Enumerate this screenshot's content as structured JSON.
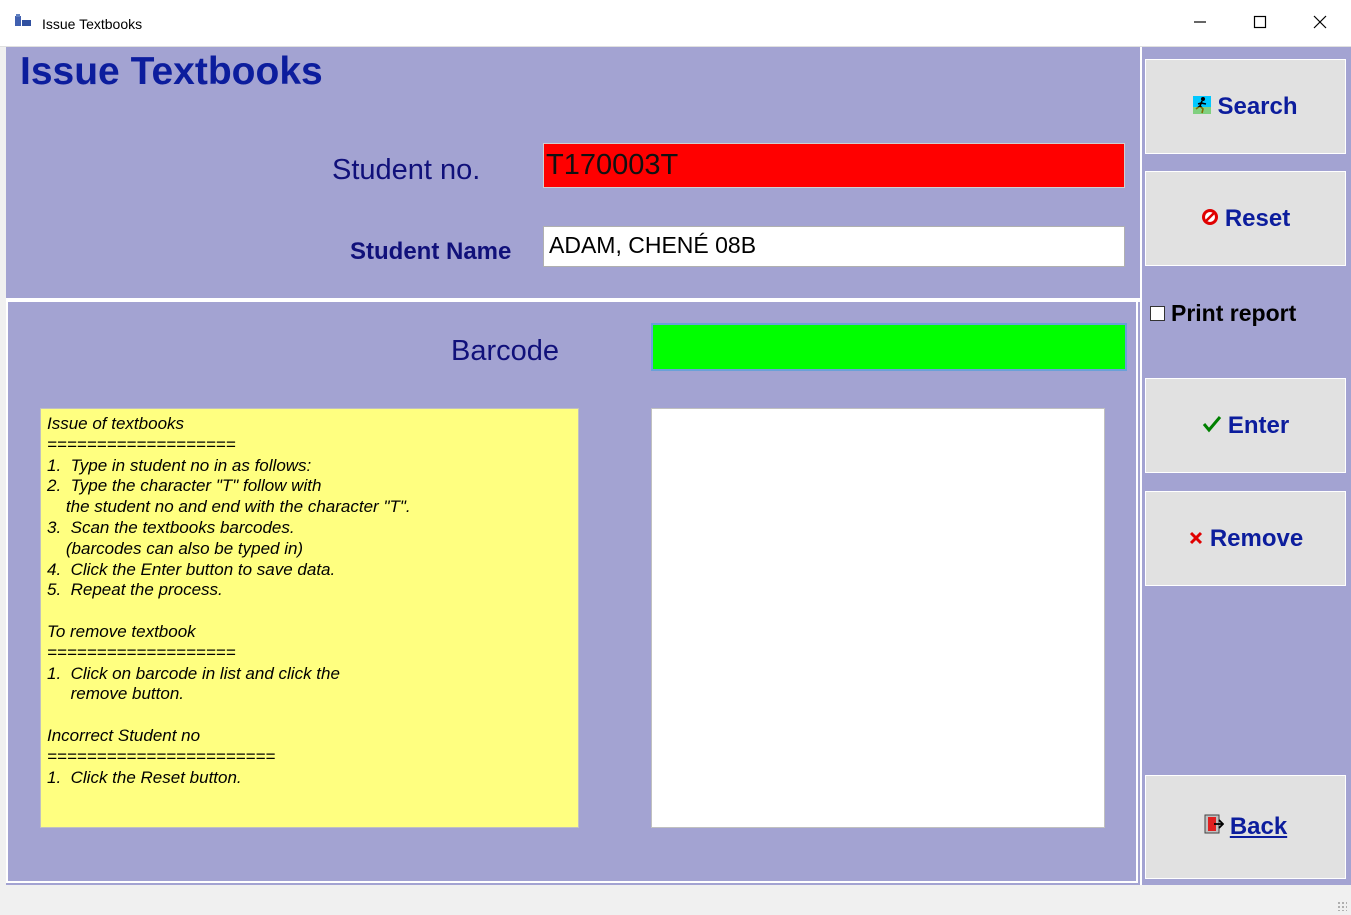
{
  "window": {
    "title": "Issue Textbooks",
    "minimize": "—",
    "maximize": "☐",
    "close": "✕"
  },
  "header": {
    "title": "Issue Textbooks"
  },
  "form": {
    "student_no_label": "Student no.",
    "student_no_value": "T170003T",
    "student_name_label": "Student Name",
    "student_name_value": "ADAM, CHENÉ 08B",
    "barcode_label": "Barcode",
    "barcode_value": ""
  },
  "instructions": "Issue of textbooks\n===================\n1.  Type in student no in as follows:\n2.  Type the character \"T\" follow with\n    the student no and end with the character \"T\".\n3.  Scan the textbooks barcodes.\n    (barcodes can also be typed in)\n4.  Click the Enter button to save data.\n5.  Repeat the process.\n\nTo remove textbook\n===================\n1.  Click on barcode in list and click the\n     remove button.\n\nIncorrect Student no\n=======================\n1.  Click the Reset button.",
  "sidebar": {
    "search_label": "Search",
    "reset_label": "Reset",
    "print_report_label": "Print report",
    "print_report_checked": false,
    "enter_label": "Enter",
    "remove_label": "Remove",
    "back_label": "Back"
  },
  "colors": {
    "background": "#a3a3d2",
    "student_no_field": "#ff0000",
    "barcode_field": "#00ff00",
    "instructions_bg": "#ffff80",
    "label_text": "#10107a"
  },
  "icons": {
    "search": "running-man-icon",
    "reset": "no-entry-icon",
    "enter": "checkmark-icon",
    "remove": "x-icon",
    "back": "exit-door-icon"
  }
}
